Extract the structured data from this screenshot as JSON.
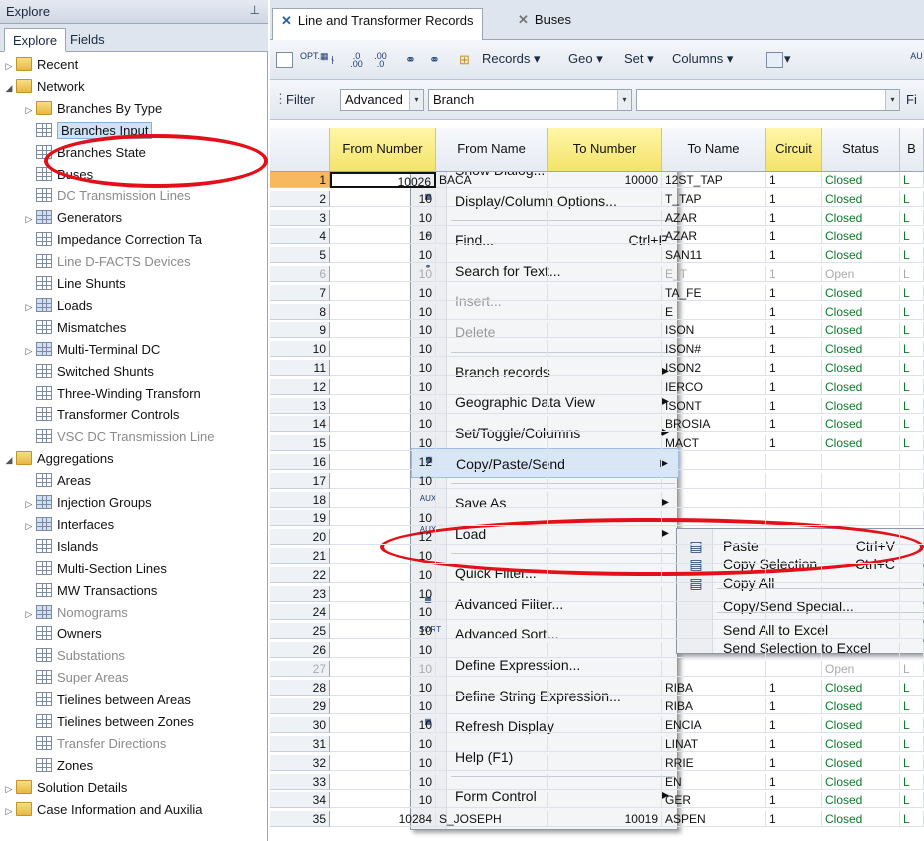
{
  "left_panel": {
    "title": "Explore",
    "pin_icon": "pin-icon",
    "tabs": [
      "Explore",
      "Fields"
    ],
    "tree": [
      {
        "label": "Recent",
        "level": 0,
        "expander": "closed",
        "icon": "folder"
      },
      {
        "label": "Network",
        "level": 0,
        "expander": "open",
        "icon": "folder"
      },
      {
        "label": "Branches By Type",
        "level": 1,
        "expander": "closed",
        "icon": "folder"
      },
      {
        "label": "Branches Input",
        "level": 1,
        "expander": "",
        "icon": "grid",
        "selected": true
      },
      {
        "label": "Branches State",
        "level": 1,
        "expander": "",
        "icon": "grid"
      },
      {
        "label": "Buses",
        "level": 1,
        "expander": "",
        "icon": "grid"
      },
      {
        "label": "DC Transmission Lines",
        "level": 1,
        "expander": "",
        "icon": "grid",
        "dim": true
      },
      {
        "label": "Generators",
        "level": 1,
        "expander": "closed",
        "icon": "multi"
      },
      {
        "label": "Impedance Correction Ta",
        "level": 1,
        "expander": "",
        "icon": "grid"
      },
      {
        "label": "Line D-FACTS Devices",
        "level": 1,
        "expander": "",
        "icon": "grid",
        "dim": true
      },
      {
        "label": "Line Shunts",
        "level": 1,
        "expander": "",
        "icon": "grid"
      },
      {
        "label": "Loads",
        "level": 1,
        "expander": "closed",
        "icon": "multi"
      },
      {
        "label": "Mismatches",
        "level": 1,
        "expander": "",
        "icon": "grid"
      },
      {
        "label": "Multi-Terminal DC",
        "level": 1,
        "expander": "closed",
        "icon": "multi"
      },
      {
        "label": "Switched Shunts",
        "level": 1,
        "expander": "",
        "icon": "grid"
      },
      {
        "label": "Three-Winding Transforn",
        "level": 1,
        "expander": "",
        "icon": "grid"
      },
      {
        "label": "Transformer Controls",
        "level": 1,
        "expander": "",
        "icon": "grid"
      },
      {
        "label": "VSC DC Transmission Line",
        "level": 1,
        "expander": "",
        "icon": "grid",
        "dim": true
      },
      {
        "label": "Aggregations",
        "level": 0,
        "expander": "open",
        "icon": "folder"
      },
      {
        "label": "Areas",
        "level": 1,
        "expander": "",
        "icon": "grid"
      },
      {
        "label": "Injection Groups",
        "level": 1,
        "expander": "closed",
        "icon": "multi"
      },
      {
        "label": "Interfaces",
        "level": 1,
        "expander": "closed",
        "icon": "multi"
      },
      {
        "label": "Islands",
        "level": 1,
        "expander": "",
        "icon": "grid"
      },
      {
        "label": "Multi-Section Lines",
        "level": 1,
        "expander": "",
        "icon": "grid"
      },
      {
        "label": "MW Transactions",
        "level": 1,
        "expander": "",
        "icon": "grid"
      },
      {
        "label": "Nomograms",
        "level": 1,
        "expander": "closed",
        "icon": "multi",
        "dim": true
      },
      {
        "label": "Owners",
        "level": 1,
        "expander": "",
        "icon": "grid"
      },
      {
        "label": "Substations",
        "level": 1,
        "expander": "",
        "icon": "grid",
        "dim": true
      },
      {
        "label": "Super Areas",
        "level": 1,
        "expander": "",
        "icon": "grid",
        "dim": true
      },
      {
        "label": "Tielines between Areas",
        "level": 1,
        "expander": "",
        "icon": "grid"
      },
      {
        "label": "Tielines between Zones",
        "level": 1,
        "expander": "",
        "icon": "grid"
      },
      {
        "label": "Transfer Directions",
        "level": 1,
        "expander": "",
        "icon": "grid",
        "dim": true
      },
      {
        "label": "Zones",
        "level": 1,
        "expander": "",
        "icon": "grid"
      },
      {
        "label": "Solution Details",
        "level": 0,
        "expander": "closed",
        "icon": "folder"
      },
      {
        "label": "Case Information and Auxilia",
        "level": 0,
        "expander": "closed",
        "icon": "folder"
      }
    ]
  },
  "doc_tabs": [
    {
      "label": "Line and Transformer Records",
      "active": true
    },
    {
      "label": "Buses",
      "active": false
    }
  ],
  "toolbar": {
    "records": "Records",
    "geo": "Geo",
    "set": "Set",
    "columns": "Columns",
    "opt_icon": "OPT."
  },
  "filter_bar": {
    "label": "Filter",
    "mode": "Advanced",
    "object": "Branch",
    "find_label": "Fi"
  },
  "columns": [
    "From Number",
    "From Name",
    "To Number",
    "To Name",
    "Circuit",
    "Status",
    "B"
  ],
  "rows": [
    {
      "n": "1",
      "from": "10026",
      "fname": "BACA",
      "to": "10000",
      "tname": "12ST_TAP",
      "ckt": "1",
      "status": "Closed",
      "dim": false
    },
    {
      "n": "2",
      "from": "10",
      "fname": "",
      "to": "",
      "tname": "T_TAP",
      "ckt": "1",
      "status": "Closed",
      "dim": false
    },
    {
      "n": "3",
      "from": "10",
      "fname": "",
      "to": "",
      "tname": "AZAR",
      "ckt": "1",
      "status": "Closed",
      "dim": false
    },
    {
      "n": "4",
      "from": "10",
      "fname": "",
      "to": "",
      "tname": "AZAR",
      "ckt": "1",
      "status": "Closed",
      "dim": false
    },
    {
      "n": "5",
      "from": "10",
      "fname": "",
      "to": "",
      "tname": "SAN11",
      "ckt": "1",
      "status": "Closed",
      "dim": false
    },
    {
      "n": "6",
      "from": "10",
      "fname": "",
      "to": "",
      "tname": "E_T",
      "ckt": "1",
      "status": "Open",
      "dim": true
    },
    {
      "n": "7",
      "from": "10",
      "fname": "",
      "to": "",
      "tname": "TA_FE",
      "ckt": "1",
      "status": "Closed",
      "dim": false
    },
    {
      "n": "8",
      "from": "10",
      "fname": "",
      "to": "",
      "tname": "E",
      "ckt": "1",
      "status": "Closed",
      "dim": false
    },
    {
      "n": "9",
      "from": "10",
      "fname": "",
      "to": "",
      "tname": "ISON",
      "ckt": "1",
      "status": "Closed",
      "dim": false
    },
    {
      "n": "10",
      "from": "10",
      "fname": "",
      "to": "",
      "tname": "ISON#",
      "ckt": "1",
      "status": "Closed",
      "dim": false
    },
    {
      "n": "11",
      "from": "10",
      "fname": "",
      "to": "",
      "tname": "ISON2",
      "ckt": "1",
      "status": "Closed",
      "dim": false
    },
    {
      "n": "12",
      "from": "10",
      "fname": "",
      "to": "",
      "tname": "IERCO",
      "ckt": "1",
      "status": "Closed",
      "dim": false
    },
    {
      "n": "13",
      "from": "10",
      "fname": "",
      "to": "",
      "tname": "ISONT",
      "ckt": "1",
      "status": "Closed",
      "dim": false
    },
    {
      "n": "14",
      "from": "10",
      "fname": "",
      "to": "",
      "tname": "BROSIA",
      "ckt": "1",
      "status": "Closed",
      "dim": false
    },
    {
      "n": "15",
      "from": "10",
      "fname": "",
      "to": "",
      "tname": "MACT",
      "ckt": "1",
      "status": "Closed",
      "dim": false
    },
    {
      "n": "16",
      "from": "12",
      "fname": "",
      "to": "",
      "tname": "",
      "ckt": "",
      "status": "",
      "dim": false
    },
    {
      "n": "17",
      "from": "10",
      "fname": "",
      "to": "",
      "tname": "",
      "ckt": "",
      "status": "",
      "dim": false
    },
    {
      "n": "18",
      "from": "",
      "fname": "",
      "to": "",
      "tname": "",
      "ckt": "",
      "status": "",
      "dim": false
    },
    {
      "n": "19",
      "from": "10",
      "fname": "",
      "to": "",
      "tname": "",
      "ckt": "",
      "status": "",
      "dim": false
    },
    {
      "n": "20",
      "from": "12",
      "fname": "",
      "to": "",
      "tname": "",
      "ckt": "",
      "status": "",
      "dim": false
    },
    {
      "n": "21",
      "from": "10",
      "fname": "",
      "to": "",
      "tname": "",
      "ckt": "",
      "status": "",
      "dim": false
    },
    {
      "n": "22",
      "from": "10",
      "fname": "",
      "to": "",
      "tname": "",
      "ckt": "",
      "status": "",
      "dim": false
    },
    {
      "n": "23",
      "from": "10",
      "fname": "",
      "to": "",
      "tname": "",
      "ckt": "",
      "status": "",
      "dim": false
    },
    {
      "n": "24",
      "from": "10",
      "fname": "",
      "to": "",
      "tname": "",
      "ckt": "",
      "status": "",
      "dim": false
    },
    {
      "n": "25",
      "from": "10",
      "fname": "",
      "to": "",
      "tname": "",
      "ckt": "",
      "status": "",
      "dim": false
    },
    {
      "n": "26",
      "from": "10",
      "fname": "",
      "to": "",
      "tname": "",
      "ckt": "",
      "status": "",
      "dim": false
    },
    {
      "n": "27",
      "from": "10",
      "fname": "",
      "to": "",
      "tname": "",
      "ckt": "",
      "status": "Open",
      "dim": true
    },
    {
      "n": "28",
      "from": "10",
      "fname": "",
      "to": "",
      "tname": "RIBA",
      "ckt": "1",
      "status": "Closed",
      "dim": false
    },
    {
      "n": "29",
      "from": "10",
      "fname": "",
      "to": "",
      "tname": "RIBA",
      "ckt": "1",
      "status": "Closed",
      "dim": false
    },
    {
      "n": "30",
      "from": "10",
      "fname": "",
      "to": "",
      "tname": "ENCIA",
      "ckt": "1",
      "status": "Closed",
      "dim": false
    },
    {
      "n": "31",
      "from": "10",
      "fname": "",
      "to": "",
      "tname": "LINAT",
      "ckt": "1",
      "status": "Closed",
      "dim": false
    },
    {
      "n": "32",
      "from": "10",
      "fname": "",
      "to": "",
      "tname": "RRIE",
      "ckt": "1",
      "status": "Closed",
      "dim": false
    },
    {
      "n": "33",
      "from": "10",
      "fname": "",
      "to": "",
      "tname": "EN",
      "ckt": "1",
      "status": "Closed",
      "dim": false
    },
    {
      "n": "34",
      "from": "10",
      "fname": "",
      "to": "",
      "tname": "GER",
      "ckt": "1",
      "status": "Closed",
      "dim": false
    },
    {
      "n": "35",
      "from": "10284",
      "fname": "S_JOSEPH",
      "to": "10019",
      "tname": "ASPEN",
      "ckt": "1",
      "status": "Closed",
      "dim": false
    }
  ],
  "context_menu": [
    {
      "label": "Show Dialog...",
      "shortcut": "",
      "submenu": false,
      "disabled": false,
      "icon": "dialog-icon"
    },
    {
      "label": "Display/Column Options...",
      "shortcut": "",
      "submenu": false,
      "disabled": false,
      "icon": "opt-grid-icon"
    },
    {
      "sep": true
    },
    {
      "label": "Find...",
      "shortcut": "Ctrl+F",
      "submenu": false,
      "disabled": false,
      "icon": "binoculars-icon"
    },
    {
      "label": "Search for Text...",
      "shortcut": "",
      "submenu": false,
      "disabled": false,
      "icon": "binoculars-abcd-icon"
    },
    {
      "label": "Insert...",
      "shortcut": "",
      "submenu": false,
      "disabled": true,
      "icon": ""
    },
    {
      "label": "Delete",
      "shortcut": "",
      "submenu": false,
      "disabled": true,
      "icon": ""
    },
    {
      "sep": true
    },
    {
      "label": "Branch records",
      "shortcut": "",
      "submenu": true,
      "disabled": false,
      "icon": ""
    },
    {
      "label": "Geographic Data View",
      "shortcut": "",
      "submenu": true,
      "disabled": false,
      "icon": ""
    },
    {
      "label": "Set/Toggle/Columns",
      "shortcut": "",
      "submenu": true,
      "disabled": false,
      "icon": ""
    },
    {
      "label": "Copy/Paste/Send",
      "shortcut": "",
      "submenu": true,
      "disabled": false,
      "icon": "copy-paste-icon",
      "highlight": true
    },
    {
      "sep": true
    },
    {
      "label": "Save As",
      "shortcut": "",
      "submenu": true,
      "disabled": false,
      "icon": "aux-save-icon"
    },
    {
      "label": "Load",
      "shortcut": "",
      "submenu": true,
      "disabled": false,
      "icon": "aux-load-icon"
    },
    {
      "sep": true
    },
    {
      "label": "Quick Filter...",
      "shortcut": "",
      "submenu": false,
      "disabled": false,
      "icon": ""
    },
    {
      "label": "Advanced Filter...",
      "shortcut": "",
      "submenu": false,
      "disabled": false,
      "icon": "filter-grid-icon"
    },
    {
      "label": "Advanced Sort...",
      "shortcut": "",
      "submenu": false,
      "disabled": false,
      "icon": "sort-icon"
    },
    {
      "label": "Define Expression...",
      "shortcut": "",
      "submenu": false,
      "disabled": false,
      "icon": ""
    },
    {
      "label": "Define String Expression...",
      "shortcut": "",
      "submenu": false,
      "disabled": false,
      "icon": ""
    },
    {
      "label": "Refresh Display",
      "shortcut": "",
      "submenu": false,
      "disabled": false,
      "icon": "refresh-grid-icon"
    },
    {
      "label": "Help (F1)",
      "shortcut": "",
      "submenu": false,
      "disabled": false,
      "icon": ""
    },
    {
      "sep": true
    },
    {
      "label": "Form Control",
      "shortcut": "",
      "submenu": true,
      "disabled": false,
      "icon": ""
    }
  ],
  "submenu": [
    {
      "label": "Paste",
      "shortcut": "Ctrl+V",
      "icon": "paste-icon"
    },
    {
      "label": "Copy Selection",
      "shortcut": "Ctrl+C",
      "icon": "copy-selection-icon"
    },
    {
      "label": "Copy All",
      "shortcut": "",
      "icon": "copy-all-icon"
    },
    {
      "sep": true
    },
    {
      "label": "Copy/Send Special...",
      "shortcut": "",
      "icon": ""
    },
    {
      "sep": true
    },
    {
      "label": "Send All to Excel",
      "shortcut": "",
      "icon": ""
    },
    {
      "label": "Send Selection to Excel",
      "shortcut": "",
      "icon": ""
    }
  ],
  "colors": {
    "highlight_ring": "#e3101a",
    "status_green": "#0d7a2c",
    "key_header": "#f4e36a"
  }
}
